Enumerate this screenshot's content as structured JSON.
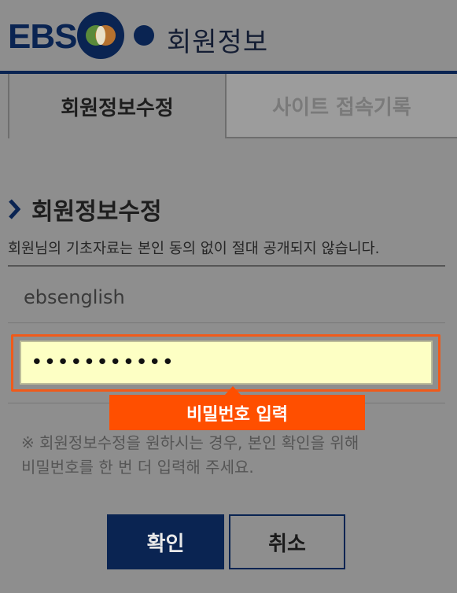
{
  "header": {
    "logo_text": "EBS",
    "title": "회원정보"
  },
  "tabs": [
    {
      "label": "회원정보수정",
      "active": true
    },
    {
      "label": "사이트 접속기록",
      "active": false
    }
  ],
  "section": {
    "title": "회원정보수정",
    "description": "회원님의 기초자료는 본인 동의 없이 절대 공개되지 않습니다."
  },
  "form": {
    "user_id": "ebsenglish",
    "password_masked": "•••••••••••"
  },
  "tooltip": {
    "text": "비밀번호 입력"
  },
  "notice": {
    "line1": "※ 회원정보수정을 원하시는 경우, 본인 확인을 위해",
    "line2": "비밀번호를 한 번 더 입력해 주세요."
  },
  "buttons": {
    "confirm": "확인",
    "cancel": "취소"
  },
  "colors": {
    "brand_navy": "#0a2452",
    "highlight_orange": "#ff4f00",
    "input_yellow": "#fdffc4"
  }
}
